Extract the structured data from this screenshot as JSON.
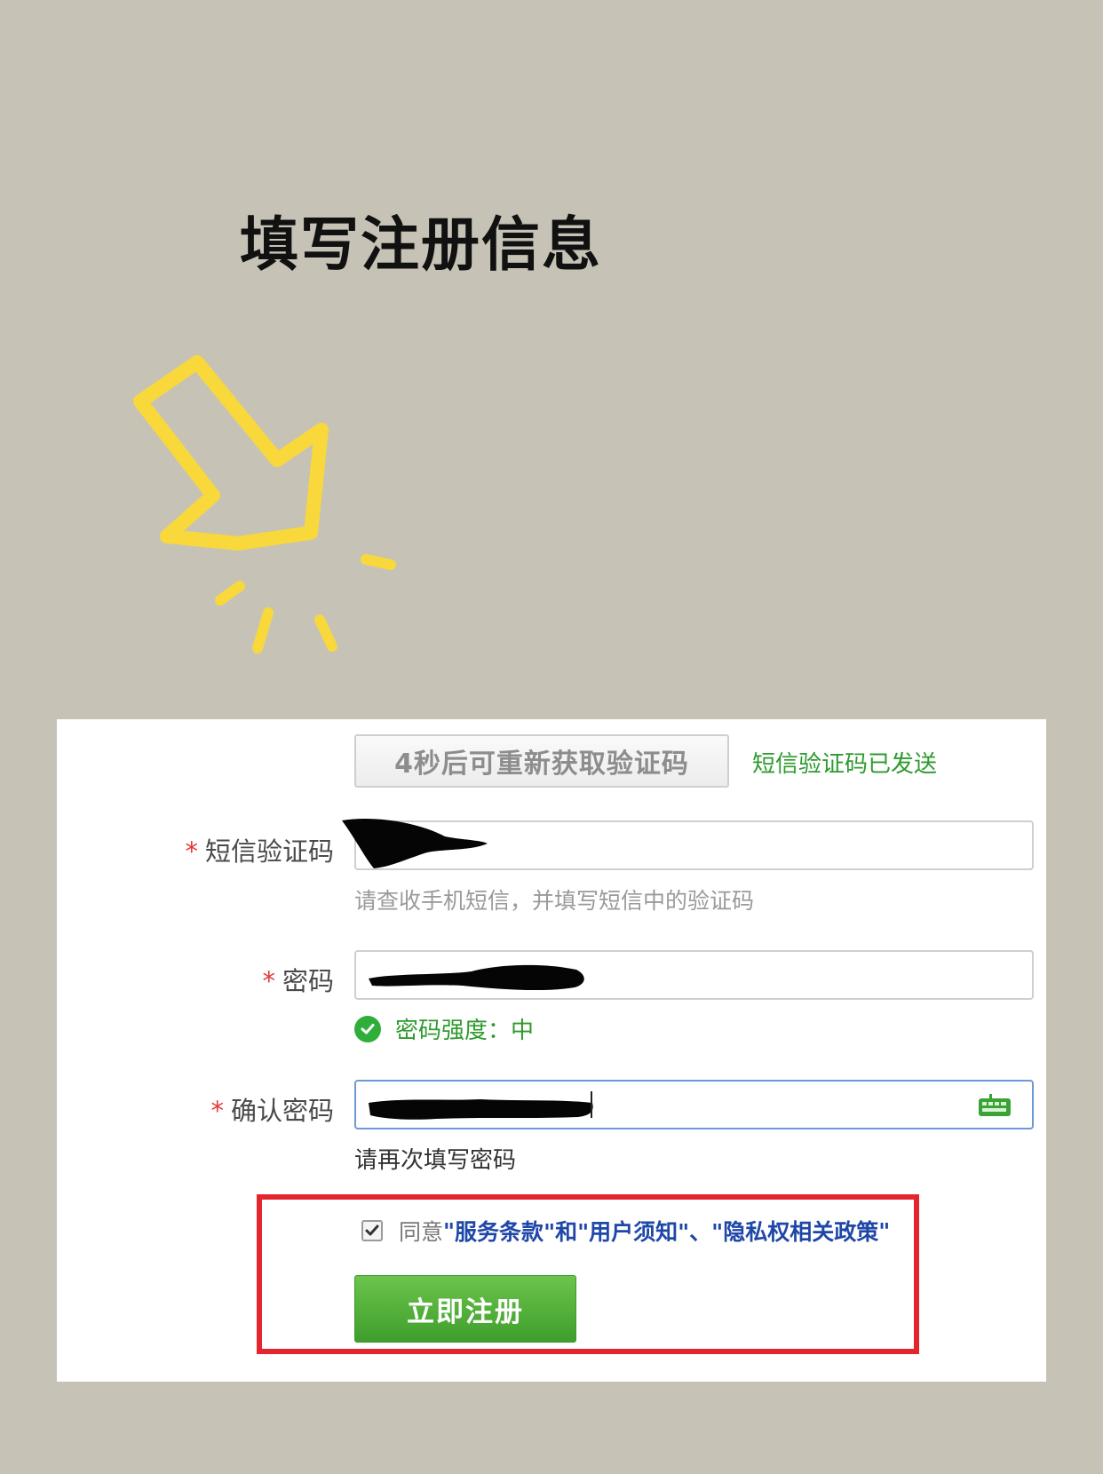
{
  "headline": "填写注册信息",
  "form": {
    "resend_button": "4秒后可重新获取验证码",
    "sms_sent_note": "短信验证码已发送",
    "required_mark": "*",
    "sms_code": {
      "label": "短信验证码",
      "hint": "请查收手机短信，并填写短信中的验证码"
    },
    "password": {
      "label": "密码",
      "strength_text": "密码强度：中"
    },
    "confirm_password": {
      "label": "确认密码",
      "hint": "请再次填写密码"
    },
    "agreement": {
      "checked": true,
      "prefix": "同意",
      "q1": "\"",
      "terms": "服务条款",
      "q2": "\"和\"",
      "notice": "用户须知",
      "q3": "\"、\"",
      "privacy": "隐私权相关政策",
      "q4": "\""
    },
    "submit_button": "立即注册"
  },
  "colors": {
    "page_background": "#c6c3b6",
    "highlight_frame": "#e3262e",
    "success_green": "#2e9a2e",
    "link_blue": "#1f47a8",
    "arrow_yellow": "#f8d83a"
  },
  "icons": [
    "hand-drawn-arrow-icon",
    "check-circle-icon",
    "keyboard-icon",
    "checkmark-icon"
  ]
}
